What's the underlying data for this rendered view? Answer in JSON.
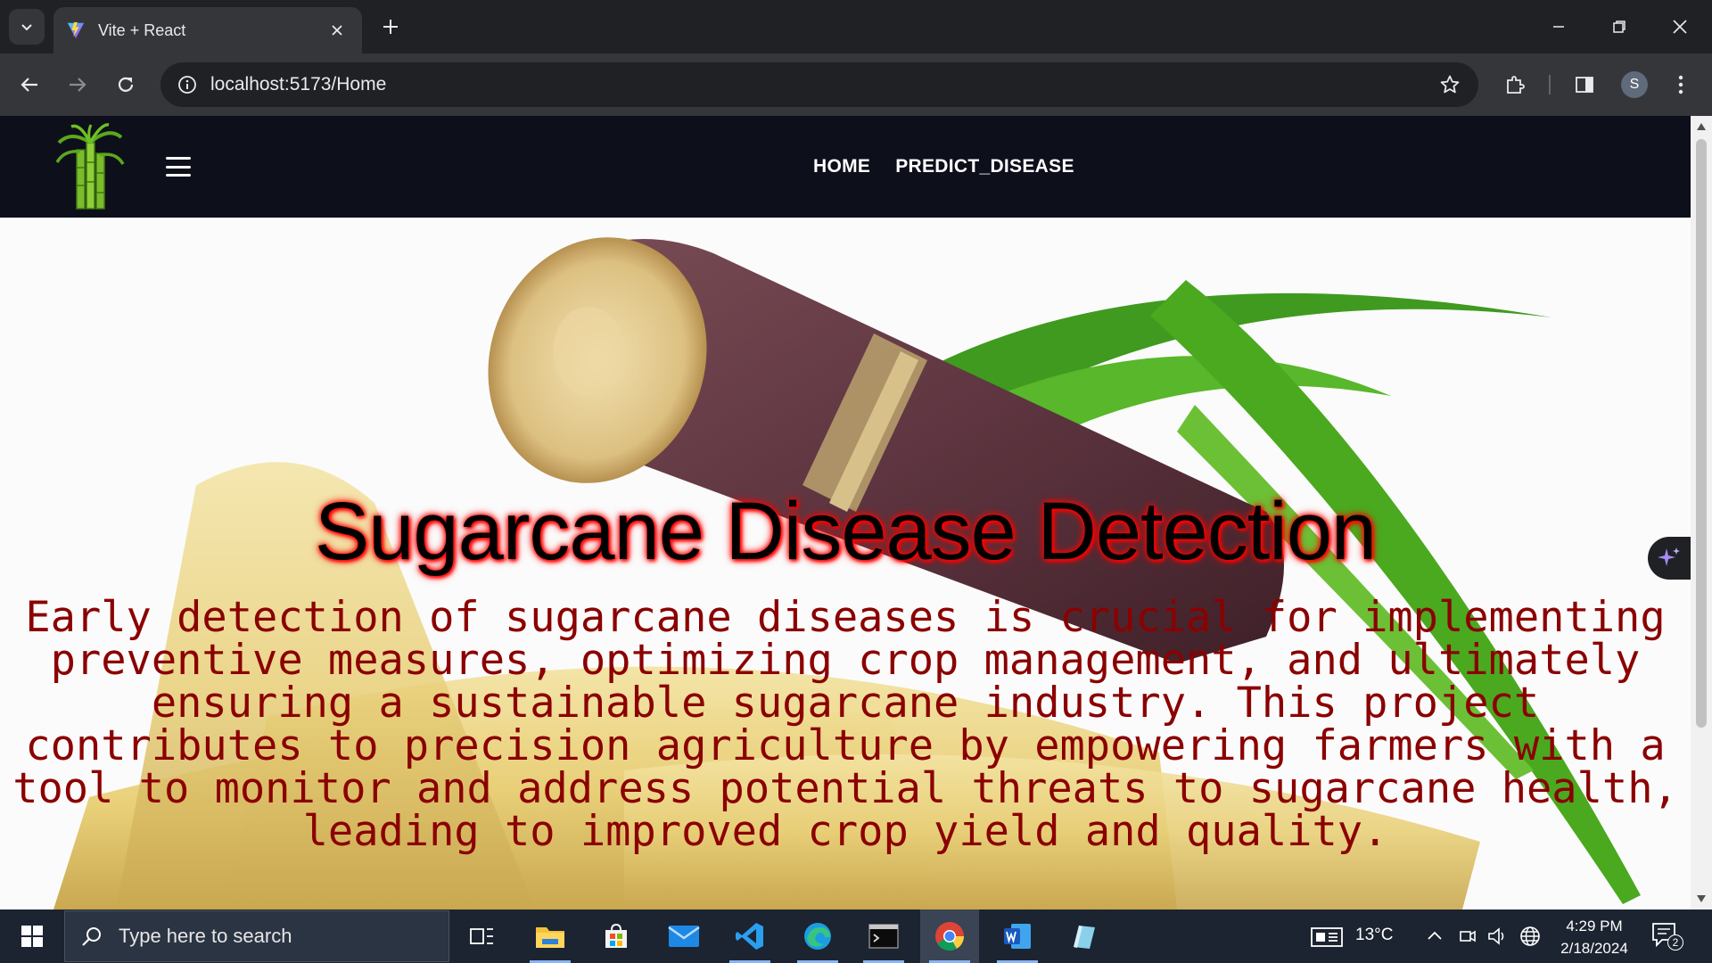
{
  "browser": {
    "tab_title": "Vite + React",
    "url": "localhost:5173/Home"
  },
  "site": {
    "nav": {
      "links": [
        "HOME",
        "PREDICT_DISEASE"
      ]
    },
    "hero": {
      "title": "Sugarcane Disease Detection",
      "description": "Early detection of sugarcane diseases is crucial for implementing preventive measures, optimizing crop management, and ultimately ensuring a sustainable sugarcane industry. This project contributes to precision agriculture by empowering farmers with a tool to monitor and address potential threats to sugarcane health, leading to improved crop yield and quality."
    }
  },
  "taskbar": {
    "search_placeholder": "Type here to search",
    "weather": "13°C",
    "time": "4:29 PM",
    "date": "2/18/2024",
    "notification_count": "2"
  },
  "colors": {
    "title_glow": "#ff0000",
    "description_text": "#8b0000",
    "navbar_bg": "#0d0f1a"
  }
}
